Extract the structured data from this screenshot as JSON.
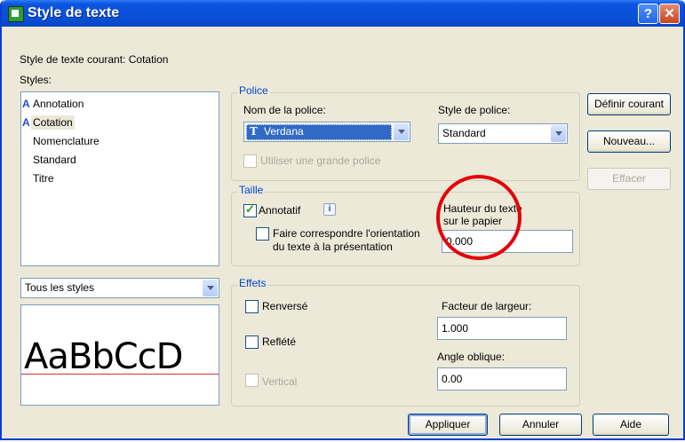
{
  "window": {
    "title": "Style de texte"
  },
  "current_style": "Style de texte courant: Cotation",
  "styles_label": "Styles:",
  "styles": [
    {
      "label": "Annotation",
      "annotative": true
    },
    {
      "label": "Cotation",
      "annotative": true,
      "selected": true
    },
    {
      "label": "Nomenclature",
      "annotative": false
    },
    {
      "label": "Standard",
      "annotative": false
    },
    {
      "label": "Titre",
      "annotative": false
    }
  ],
  "filter": {
    "selected": "Tous les styles"
  },
  "preview": {
    "text": "AaBbCcD"
  },
  "police": {
    "group_label": "Police",
    "font_name_label": "Nom de la police:",
    "font_name_value": "Verdana",
    "font_style_label": "Style de police:",
    "font_style_value": "Standard",
    "big_font_label": "Utiliser une grande police"
  },
  "taille": {
    "group_label": "Taille",
    "annotative_label": "Annotatif",
    "annotative_checked": true,
    "match_orientation_line1": "Faire correspondre l'orientation",
    "match_orientation_line2": "du texte à la présentation",
    "height_label_line1": "Hauteur du texte",
    "height_label_line2": "sur le papier",
    "height_value": "0.000"
  },
  "effets": {
    "group_label": "Effets",
    "reversed_label": "Renversé",
    "mirrored_label": "Reflété",
    "vertical_label": "Vertical",
    "width_factor_label": "Facteur de largeur:",
    "width_factor_value": "1.000",
    "oblique_label": "Angle oblique:",
    "oblique_value": "0.00"
  },
  "buttons": {
    "set_current": "Définir courant",
    "new": "Nouveau...",
    "delete": "Effacer",
    "apply": "Appliquer",
    "cancel": "Annuler",
    "help": "Aide"
  },
  "colors": {
    "title_bar": "#0a4fd6",
    "group_title": "#0046d5",
    "highlight_circle": "#e4000a"
  },
  "icons": {
    "font_type": "truetype-icon",
    "annotative": "annotative-scale-icon",
    "info": "info-icon"
  }
}
